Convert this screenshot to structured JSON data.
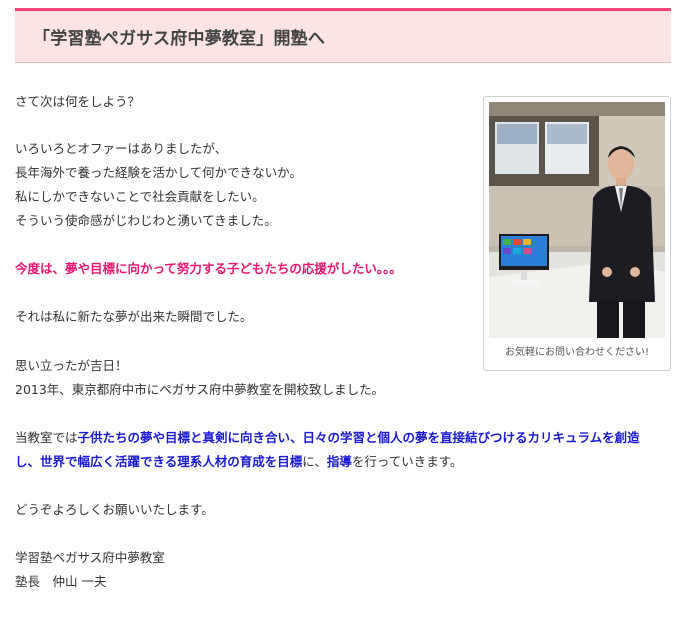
{
  "heading": {
    "title": "「学習塾ペガサス府中夢教室」開塾へ"
  },
  "body": {
    "p1": "さて次は何をしよう？",
    "p2_l1": "いろいろとオファーはありましたが、",
    "p2_l2": "長年海外で養った経験を活かして何かできないか。",
    "p2_l3": "私にしかできないことで社会貢献をしたい。",
    "p2_l4": "そういう使命感がじわじわと湧いてきました。",
    "highlight": "今度は、夢や目標に向かって努力する子どもたちの応援がしたい。。。",
    "p4": "それは私に新たな夢が出来た瞬間でした。",
    "p5_l1": "思い立ったが吉日！",
    "p5_l2": "2013年、東京都府中市にペガサス府中夢教室を開校致しました。",
    "p6_prefix": "当教室では",
    "p6_bold1": "子供たちの夢や目標と真剣に向き合い、日々の学習と個人の夢を直接結びつけるカリキュラムを創造",
    "p6_bold2": "し、世界で幅広く活躍できる理系人材の育成を目標",
    "p6_mid": "に、",
    "p6_bold3": "指導",
    "p6_suffix": "を行っていきます。",
    "p7": "どうぞよろしくお願いいたします。",
    "sig_l1": "学習塾ペガサス府中夢教室",
    "sig_l2": "塾長　仲山 一夫"
  },
  "photo": {
    "caption": "お気軽にお問い合わせください!"
  },
  "colors": {
    "accent": "#f0477a",
    "heading_bg": "#fde4e4",
    "pink_text": "#e6176f",
    "blue_text": "#1a1ad0"
  }
}
